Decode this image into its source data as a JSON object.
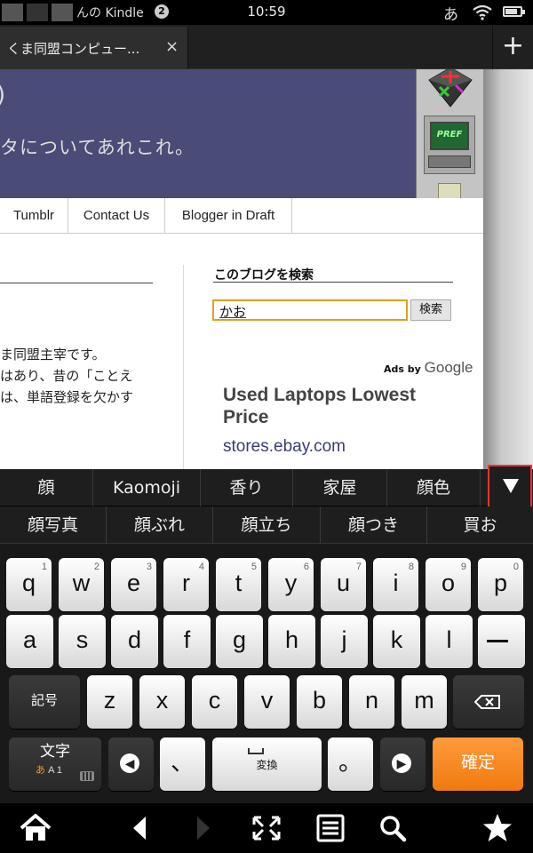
{
  "status": {
    "owner": "んの Kindle",
    "notif_count": "2",
    "time": "10:59",
    "ime": "あ"
  },
  "tabs": {
    "title": "くま同盟コンピュー...",
    "close": "×",
    "new_tab": "+"
  },
  "blog": {
    "banner_paren": ")",
    "banner_subtitle": "タについてあれこれ。",
    "nav_items": [
      "Tumblr",
      "Contact Us",
      "Blogger in Draft"
    ],
    "post_lines": [
      "ま同盟主宰です。",
      "はあり、昔の「ことえ",
      "は、単語登録を欠かす"
    ],
    "search": {
      "heading": "このブログを検索",
      "value": "かお",
      "button": "検索"
    },
    "ads": {
      "ads_by": "Ads by ",
      "brand": "Google",
      "title": "Used Laptops Lowest Price",
      "url": "stores.ebay.com"
    },
    "pref_label": "PREF"
  },
  "ime": {
    "candidates_row1": [
      "顔",
      "Kaomoji",
      "香り",
      "家屋",
      "顔色"
    ],
    "candidates_row2": [
      "顔写真",
      "顔ぶれ",
      "顔立ち",
      "顔つき",
      "買お"
    ]
  },
  "keyboard": {
    "row1": [
      {
        "label": "q",
        "hint": "1"
      },
      {
        "label": "w",
        "hint": "2"
      },
      {
        "label": "e",
        "hint": "3"
      },
      {
        "label": "r",
        "hint": "4"
      },
      {
        "label": "t",
        "hint": "5"
      },
      {
        "label": "y",
        "hint": "6"
      },
      {
        "label": "u",
        "hint": "7"
      },
      {
        "label": "i",
        "hint": "8"
      },
      {
        "label": "o",
        "hint": "9"
      },
      {
        "label": "p",
        "hint": "0"
      }
    ],
    "row2": [
      "a",
      "s",
      "d",
      "f",
      "g",
      "h",
      "j",
      "k",
      "l"
    ],
    "row3": [
      "z",
      "x",
      "c",
      "v",
      "b",
      "n",
      "m"
    ],
    "symbols": "記号",
    "moji": {
      "top": "文字",
      "kana": "あ",
      "rest": "A 1"
    },
    "comma": "、",
    "space": "変換",
    "period": "。",
    "enter": "確定"
  },
  "colors": {
    "enter_key": "#f07a10",
    "highlight_border": "#e33333",
    "banner": "#4b4b78",
    "search_border": "#e0a020"
  }
}
